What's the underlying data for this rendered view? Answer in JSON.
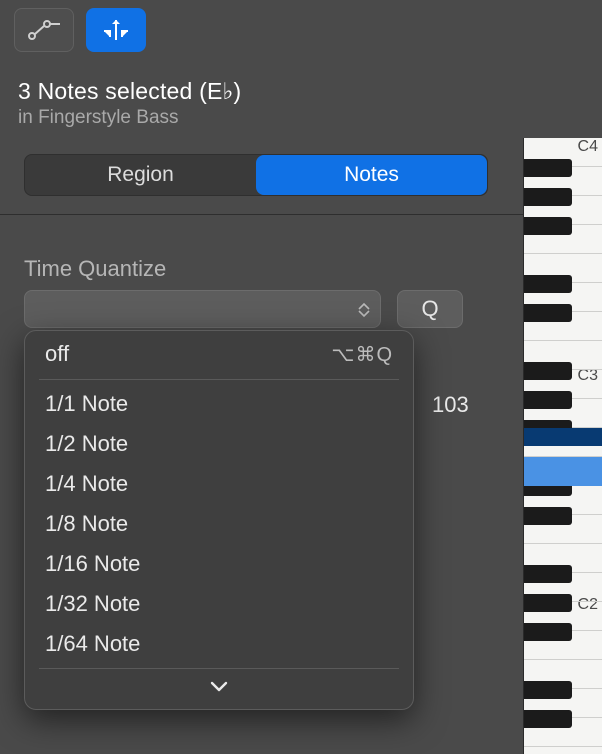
{
  "header": {
    "title": "3 Notes selected (E♭)",
    "subtitle": "in Fingerstyle Bass"
  },
  "segmented": {
    "region": "Region",
    "notes": "Notes",
    "active": "notes"
  },
  "time_quantize": {
    "label": "Time Quantize",
    "field_value": "",
    "q_button": "Q",
    "value_display": "103"
  },
  "menu": {
    "off_label": "off",
    "off_shortcut": "⌥⌘Q",
    "items": [
      "1/1 Note",
      "1/2 Note",
      "1/4 Note",
      "1/8 Note",
      "1/16 Note",
      "1/32 Note",
      "1/64 Note"
    ]
  },
  "piano": {
    "labels": {
      "c4": "C4",
      "c3": "C3",
      "c2": "C2"
    }
  }
}
